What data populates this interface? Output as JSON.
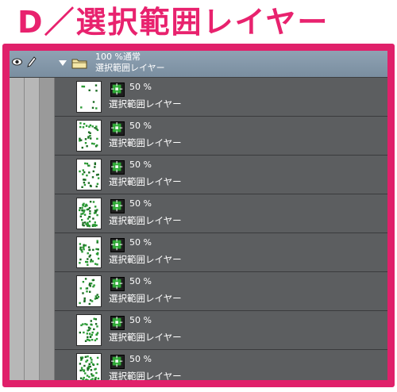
{
  "header": {
    "title": "D／選択範囲レイヤー"
  },
  "folder": {
    "opacity_mode": "100 %通常",
    "name": "選択範囲レイヤー"
  },
  "layers": [
    {
      "opacity": "50 %",
      "name": "選択範囲レイヤー"
    },
    {
      "opacity": "50 %",
      "name": "選択範囲レイヤー"
    },
    {
      "opacity": "50 %",
      "name": "選択範囲レイヤー"
    },
    {
      "opacity": "50 %",
      "name": "選択範囲レイヤー"
    },
    {
      "opacity": "50 %",
      "name": "選択範囲レイヤー"
    },
    {
      "opacity": "50 %",
      "name": "選択範囲レイヤー"
    },
    {
      "opacity": "50 %",
      "name": "選択範囲レイヤー"
    },
    {
      "opacity": "50 %",
      "name": "選択範囲レイヤー"
    }
  ],
  "colors": {
    "accent": "#e0206a",
    "panel": "#5c5e60",
    "folder_bar": "#8fa2b3",
    "selection_green": "#2fa836"
  },
  "icons": [
    "eye-icon",
    "pen-icon",
    "expand-arrow-icon",
    "folder-icon",
    "selection-layer-icon"
  ]
}
